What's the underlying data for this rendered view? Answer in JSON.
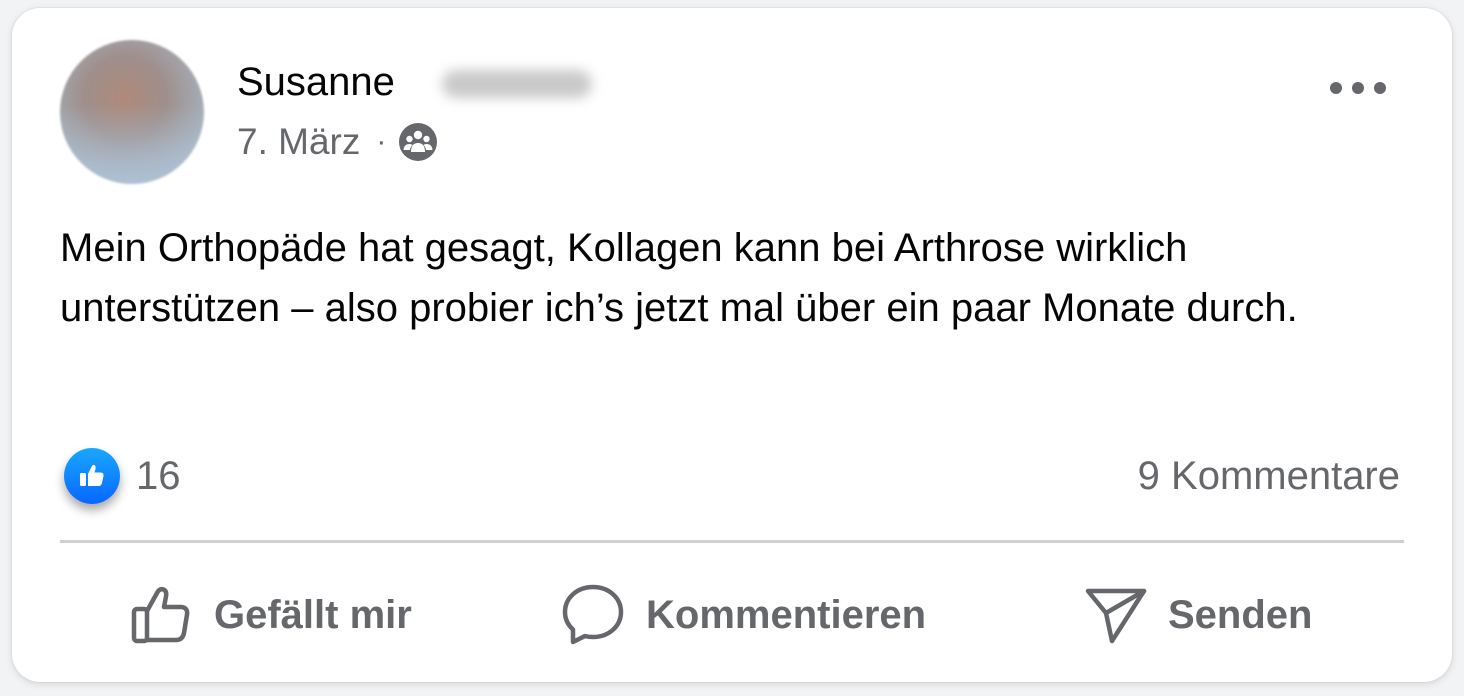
{
  "post": {
    "author_first_name": "Susanne",
    "date": "7. März",
    "separator": "·",
    "audience_icon": "group-audience-icon",
    "text": "Mein Orthopäde hat gesagt, Kollagen kann bei Arthrose wirklich unterstützen – also probier ich’s jetzt mal über ein paar Monate durch."
  },
  "reactions": {
    "like_count": "16",
    "comments_label": "9 Kommentare",
    "like_icon": "thumbs-up-icon"
  },
  "actions": {
    "like_label": "Gefällt mir",
    "comment_label": "Kommentieren",
    "send_label": "Senden"
  },
  "colors": {
    "like_blue": "#0866ff",
    "text_primary": "#050505",
    "text_secondary": "#65676b",
    "divider": "#ced0d4"
  }
}
